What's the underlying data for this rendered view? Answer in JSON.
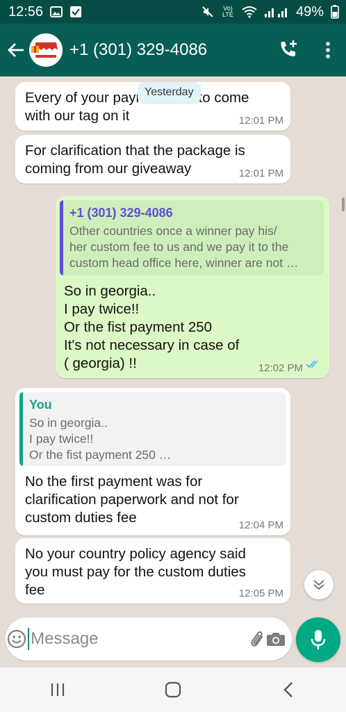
{
  "status_bar": {
    "time": "12:56",
    "network_label": "Vo) LTE",
    "battery": "49%"
  },
  "header": {
    "contact_title": "+1 (301) 329-4086",
    "avatar_text": "GIVEAWAY"
  },
  "chat": {
    "date_chip": "Yesterday",
    "messages": [
      {
        "text": "Every of your payment has to come\nwith our tag on it",
        "time": "12:01 PM"
      },
      {
        "text": "For clarification that the package is\ncoming from our giveaway",
        "time": "12:01 PM"
      },
      {
        "quote_name": "+1 (301) 329-4086",
        "quote_text": "Other countries once a winner pay his/\nher custom fee to us and we pay it to the\ncustom head office here, winner are not …",
        "text": "So in georgia..\nI pay twice!!\nOr the fist payment 250\nIt's not necessary in case of\n( georgia) !!",
        "time": "12:02 PM"
      },
      {
        "quote_name": "You",
        "quote_text": "So in georgia..\nI pay twice!!\nOr the fist payment 250 …",
        "text": "No the first payment was for\nclarification paperwork and not for\ncustom duties fee",
        "time": "12:04 PM"
      },
      {
        "text": "No your country policy agency said\nyou must pay for the custom duties\nfee",
        "time": "12:05 PM"
      }
    ]
  },
  "composer": {
    "placeholder": "Message"
  },
  "colors": {
    "header": "#075e54",
    "outgoing_bubble": "#dcf8c6",
    "accent": "#00a884",
    "read_ticks": "#4fb6ec"
  }
}
